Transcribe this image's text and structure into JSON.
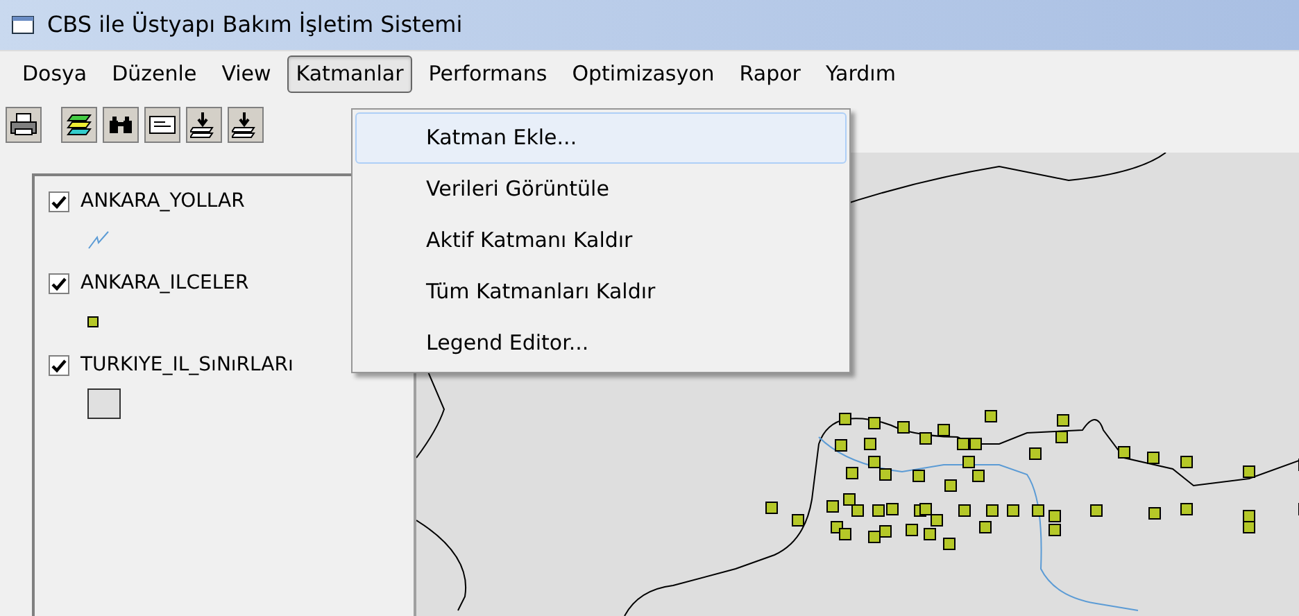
{
  "window": {
    "title": "CBS ile Üstyapı Bakım İşletim Sistemi"
  },
  "menu_bar": [
    {
      "label": "Dosya",
      "selected": false
    },
    {
      "label": "Düzenle",
      "selected": false
    },
    {
      "label": "View",
      "selected": false
    },
    {
      "label": "Katmanlar",
      "selected": true
    },
    {
      "label": "Performans",
      "selected": false
    },
    {
      "label": "Optimizasyon",
      "selected": false
    },
    {
      "label": "Rapor",
      "selected": false
    },
    {
      "label": "Yardım",
      "selected": false
    }
  ],
  "dropdown": [
    {
      "label": "Katman Ekle...",
      "selected": true
    },
    {
      "label": "Verileri Görüntüle",
      "selected": false
    },
    {
      "label": "Aktif Katmanı Kaldır",
      "selected": false
    },
    {
      "label": "Tüm Katmanları Kaldır",
      "selected": false
    },
    {
      "label": "Legend Editor...",
      "selected": false
    }
  ],
  "legend": [
    {
      "name": "ANKARA_YOLLAR",
      "checked": true,
      "kind": "line"
    },
    {
      "name": "ANKARA_ILCELER",
      "checked": true,
      "kind": "point"
    },
    {
      "name": "TURKIYE_IL_SıNıRLARı",
      "checked": true,
      "kind": "polygon"
    }
  ]
}
